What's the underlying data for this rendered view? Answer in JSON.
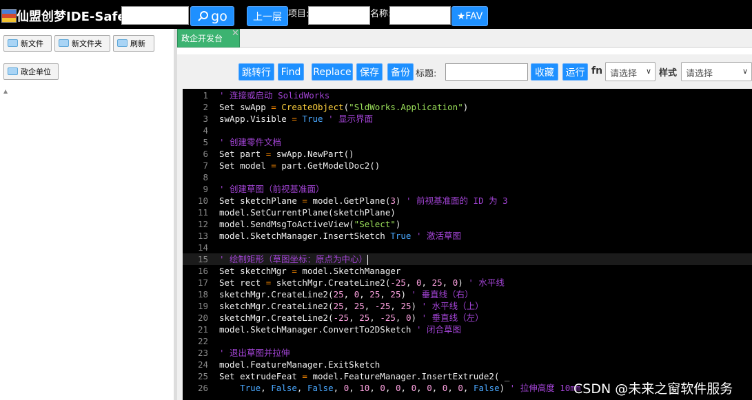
{
  "header": {
    "app_title": "仙盟创梦IDE-Safe",
    "search_value": "",
    "go_label": "go",
    "up_label": "上一层",
    "project_label": "项目:",
    "project_value": "",
    "name_label": "名称:",
    "name_value": "",
    "fav_label": "★FAV"
  },
  "sidebar": {
    "new_file": "新文件",
    "new_folder": "新文件夹",
    "refresh": "刷新",
    "tree_items": [
      "政企单位"
    ]
  },
  "tabs": [
    {
      "label": "政企开发台"
    }
  ],
  "toolbar": {
    "goto": "跳转行",
    "find": "Find",
    "replace": "Replace",
    "save": "保存",
    "backup": "备份",
    "title_label": "标题:",
    "title_value": "",
    "collect": "收藏",
    "run": "运行",
    "fn_label": "fn",
    "fn_select": "请选择",
    "style_label": "样式",
    "style_select": "请选择"
  },
  "editor": {
    "active_line": 15,
    "lines": [
      {
        "n": "1",
        "tokens": [
          [
            "c",
            "' 连接或启动 SolidWorks"
          ]
        ]
      },
      {
        "n": "2",
        "tokens": [
          [
            "p",
            "Set swApp "
          ],
          [
            "o",
            "="
          ],
          [
            "p",
            " "
          ],
          [
            "f",
            "CreateObject"
          ],
          [
            "p",
            "("
          ],
          [
            "s",
            "\"SldWorks.Application\""
          ],
          [
            "p",
            ")"
          ]
        ]
      },
      {
        "n": "3",
        "tokens": [
          [
            "p",
            "swApp.Visible "
          ],
          [
            "o",
            "="
          ],
          [
            "p",
            " "
          ],
          [
            "k",
            "True"
          ],
          [
            "p",
            " "
          ],
          [
            "c",
            "' 显示界面"
          ]
        ]
      },
      {
        "n": "4",
        "tokens": []
      },
      {
        "n": "5",
        "tokens": [
          [
            "c",
            "' 创建零件文档"
          ]
        ]
      },
      {
        "n": "6",
        "tokens": [
          [
            "p",
            "Set part "
          ],
          [
            "o",
            "="
          ],
          [
            "p",
            " swApp.NewPart()"
          ]
        ]
      },
      {
        "n": "7",
        "tokens": [
          [
            "p",
            "Set model "
          ],
          [
            "o",
            "="
          ],
          [
            "p",
            " part.GetModelDoc2()"
          ]
        ]
      },
      {
        "n": "8",
        "tokens": []
      },
      {
        "n": "9",
        "tokens": [
          [
            "c",
            "' 创建草图（前视基准面）"
          ]
        ]
      },
      {
        "n": "10",
        "tokens": [
          [
            "p",
            "Set sketchPlane "
          ],
          [
            "o",
            "="
          ],
          [
            "p",
            " model.GetPlane("
          ],
          [
            "n",
            "3"
          ],
          [
            "p",
            ") "
          ],
          [
            "c",
            "' 前视基准面的 ID 为 3"
          ]
        ]
      },
      {
        "n": "11",
        "tokens": [
          [
            "p",
            "model.SetCurrentPlane(sketchPlane)"
          ]
        ]
      },
      {
        "n": "12",
        "tokens": [
          [
            "p",
            "model.SendMsgToActiveView("
          ],
          [
            "s",
            "\"Select\""
          ],
          [
            "p",
            ")"
          ]
        ]
      },
      {
        "n": "13",
        "tokens": [
          [
            "p",
            "model.SketchManager.InsertSketch "
          ],
          [
            "k",
            "True"
          ],
          [
            "p",
            " "
          ],
          [
            "c",
            "' 激活草图"
          ]
        ]
      },
      {
        "n": "14",
        "tokens": []
      },
      {
        "n": "15",
        "tokens": [
          [
            "c",
            "' 绘制矩形（草图坐标：原点为中心）"
          ]
        ]
      },
      {
        "n": "16",
        "tokens": [
          [
            "p",
            "Set sketchMgr "
          ],
          [
            "o",
            "="
          ],
          [
            "p",
            " model.SketchManager"
          ]
        ]
      },
      {
        "n": "17",
        "tokens": [
          [
            "p",
            "Set rect "
          ],
          [
            "o",
            "="
          ],
          [
            "p",
            " sketchMgr.CreateLine2("
          ],
          [
            "n",
            "-25"
          ],
          [
            "p",
            ", "
          ],
          [
            "n",
            "0"
          ],
          [
            "p",
            ", "
          ],
          [
            "n",
            "25"
          ],
          [
            "p",
            ", "
          ],
          [
            "n",
            "0"
          ],
          [
            "p",
            ") "
          ],
          [
            "c",
            "' 水平线"
          ]
        ]
      },
      {
        "n": "18",
        "tokens": [
          [
            "p",
            "sketchMgr.CreateLine2("
          ],
          [
            "n",
            "25"
          ],
          [
            "p",
            ", "
          ],
          [
            "n",
            "0"
          ],
          [
            "p",
            ", "
          ],
          [
            "n",
            "25"
          ],
          [
            "p",
            ", "
          ],
          [
            "n",
            "25"
          ],
          [
            "p",
            ") "
          ],
          [
            "c",
            "' 垂直线（右）"
          ]
        ]
      },
      {
        "n": "19",
        "tokens": [
          [
            "p",
            "sketchMgr.CreateLine2("
          ],
          [
            "n",
            "25"
          ],
          [
            "p",
            ", "
          ],
          [
            "n",
            "25"
          ],
          [
            "p",
            ", "
          ],
          [
            "n",
            "-25"
          ],
          [
            "p",
            ", "
          ],
          [
            "n",
            "25"
          ],
          [
            "p",
            ") "
          ],
          [
            "c",
            "' 水平线（上）"
          ]
        ]
      },
      {
        "n": "20",
        "tokens": [
          [
            "p",
            "sketchMgr.CreateLine2("
          ],
          [
            "n",
            "-25"
          ],
          [
            "p",
            ", "
          ],
          [
            "n",
            "25"
          ],
          [
            "p",
            ", "
          ],
          [
            "n",
            "-25"
          ],
          [
            "p",
            ", "
          ],
          [
            "n",
            "0"
          ],
          [
            "p",
            ") "
          ],
          [
            "c",
            "' 垂直线（左）"
          ]
        ]
      },
      {
        "n": "21",
        "tokens": [
          [
            "p",
            "model.SketchManager.ConvertTo2DSketch "
          ],
          [
            "c",
            "' 闭合草图"
          ]
        ]
      },
      {
        "n": "22",
        "tokens": []
      },
      {
        "n": "23",
        "tokens": [
          [
            "c",
            "' 退出草图并拉伸"
          ]
        ]
      },
      {
        "n": "24",
        "tokens": [
          [
            "p",
            "model.FeatureManager.ExitSketch"
          ]
        ]
      },
      {
        "n": "25",
        "tokens": [
          [
            "p",
            "Set extrudeFeat "
          ],
          [
            "o",
            "="
          ],
          [
            "p",
            " model.FeatureManager.InsertExtrude2( _"
          ]
        ]
      },
      {
        "n": "26",
        "tokens": [
          [
            "p",
            "    "
          ],
          [
            "k",
            "True"
          ],
          [
            "p",
            ", "
          ],
          [
            "k",
            "False"
          ],
          [
            "p",
            ", "
          ],
          [
            "k",
            "False"
          ],
          [
            "p",
            ", "
          ],
          [
            "n",
            "0"
          ],
          [
            "p",
            ", "
          ],
          [
            "n",
            "10"
          ],
          [
            "p",
            ", "
          ],
          [
            "n",
            "0"
          ],
          [
            "p",
            ", "
          ],
          [
            "n",
            "0"
          ],
          [
            "p",
            ", "
          ],
          [
            "n",
            "0"
          ],
          [
            "p",
            ", "
          ],
          [
            "n",
            "0"
          ],
          [
            "p",
            ", "
          ],
          [
            "n",
            "0"
          ],
          [
            "p",
            ", "
          ],
          [
            "n",
            "0"
          ],
          [
            "p",
            ", "
          ],
          [
            "k",
            "False"
          ],
          [
            "p",
            ") "
          ],
          [
            "c",
            "' 拉伸高度 10mm"
          ]
        ]
      }
    ]
  },
  "watermark": "CSDN @未来之窗软件服务"
}
